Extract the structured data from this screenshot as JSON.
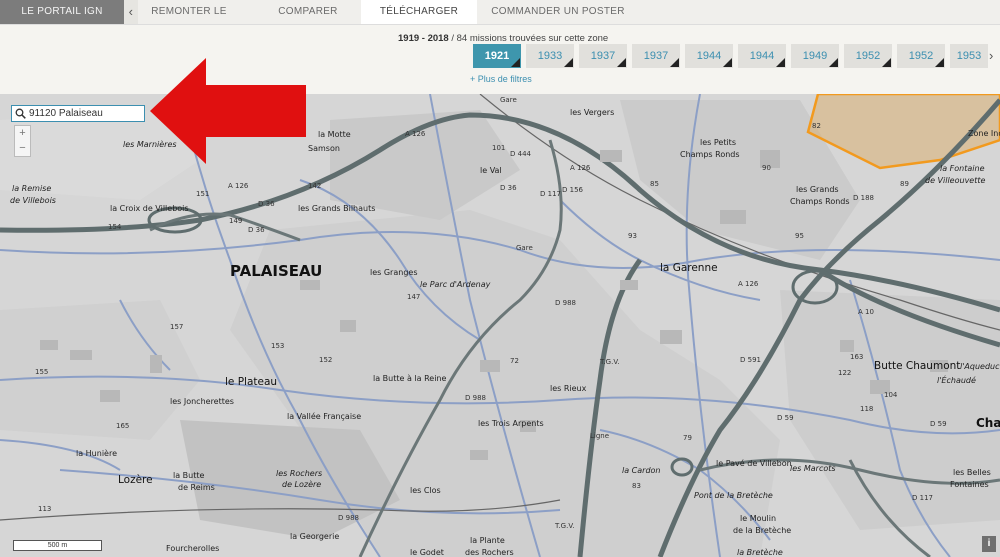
{
  "tabs": {
    "portal": "LE PORTAIL IGN",
    "back": "‹",
    "items": [
      "REMONTER LE TEMPS",
      "COMPARER",
      "TÉLÉCHARGER",
      "COMMANDER UN POSTER"
    ]
  },
  "missions": {
    "range": "1919 - 2018",
    "count_text": " / 84 missions trouvées sur cette zone",
    "years": [
      "1921",
      "1933",
      "1937",
      "1937",
      "1944",
      "1944",
      "1949",
      "1952",
      "1952",
      "1953"
    ],
    "selected_year": "1921",
    "next_arrow": "›",
    "more_filters": "+ Plus de filtres"
  },
  "search": {
    "value": "91120 Palaiseau",
    "icon": "search-icon"
  },
  "zoom": {
    "in": "+",
    "out": "−"
  },
  "scale": "500 m",
  "info_button": "i",
  "colors": {
    "accent": "#3e96ad",
    "arrow": "#e01010",
    "zone": "#f29a1e"
  },
  "map_labels": {
    "palaiseau": "PALAISEAU",
    "lozere": "Lozère",
    "le_plateau": "le Plateau",
    "les_marnieres": "les Marnières",
    "la_remise": "la Remise",
    "de_villebois": "de Villebois",
    "la_croix_villebois": "la Croix de Villebois",
    "la_motte": "la Motte",
    "samson": "Samson",
    "les_grands_bilhauts": "les Grands Bilhauts",
    "les_granges": "les Granges",
    "le_parc": "le Parc d'Ardenay",
    "les_vergers": "les Vergers",
    "le_val": "le Val",
    "les_petits": "les Petits",
    "champs_ronds": "Champs Ronds",
    "les_grands": "les Grands",
    "champs_ronds2": "Champs Ronds",
    "zone_ind": "Zone Ind",
    "la_fontaine": "la Fontaine",
    "de_villeouvette": "de Villeouvette",
    "la_garenne": "la Garenne",
    "butte_chaumont": "Butte Chaumont",
    "l_aqueduc": "l'Aqueduc",
    "l_echaude": "l'Échaudé",
    "la_butte_reine": "la Butte à la Reine",
    "les_rieux": "les Rieux",
    "les_trois_arpents": "les Trois Arpents",
    "les_joncherettes": "les Joncherettes",
    "la_vallee_francaise": "la Vallée Française",
    "la_huniere": "la Hunière",
    "la_butte": "la Butte",
    "de_reims": "de Reims",
    "les_rochers": "les Rochers",
    "de_lozere": "de Lozère",
    "les_clos": "les Clos",
    "la_georgerie": "la Georgerie",
    "fourcherolles": "Fourcherolles",
    "le_godet": "le Godet",
    "la_plante": "la Plante",
    "des_rochers": "des Rochers",
    "la_cardon": "la Cardon",
    "le_pave": "le Pavé de Villebon",
    "les_marcots": "les Marcots",
    "pont_breteche": "Pont de la Bretèche",
    "le_moulin": "le Moulin",
    "de_la_breteche": "de la Bretèche",
    "la_breteche": "la Bretèche",
    "les_belles": "les Belles",
    "fontaines": "Fontaines",
    "cha": "Cha",
    "a126_1": "A 126",
    "a126_2": "A 126",
    "a126_3": "A 126",
    "a126_4": "A 126",
    "a10": "A 10",
    "d36": "D 36",
    "d36b": "D 36",
    "d36c": "D 36",
    "d444": "D 444",
    "d117": "D 117",
    "d156": "D 156",
    "d988": "D 988",
    "d988b": "D 988",
    "d988c": "D 988",
    "d591": "D 591",
    "d59": "D 59",
    "d59b": "D 59",
    "d188": "D 188",
    "d117b": "D 117",
    "tgv": "T.G.V.",
    "tgv2": "T.G.V.",
    "ligne": "Ligne",
    "gare": "Gare",
    "gare2": "Gare",
    "n151": "151",
    "n149": "149",
    "n154": "154",
    "n142": "142",
    "n157": "157",
    "n153": "153",
    "n152": "152",
    "n147": "147",
    "n72": "72",
    "n93": "93",
    "n90": "90",
    "n95": "95",
    "n89": "89",
    "n122": "122",
    "n163": "163",
    "n101": "101",
    "n85": "85",
    "n82": "82",
    "n155": "155",
    "n165": "165",
    "n113": "113",
    "n118": "118",
    "n104": "104",
    "n79": "79",
    "n83": "83"
  }
}
